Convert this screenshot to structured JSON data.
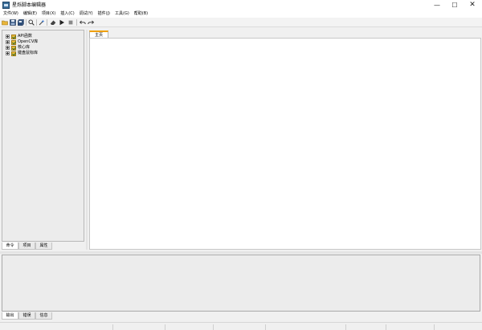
{
  "window": {
    "title": "星烁脚本编辑器",
    "controls": {
      "minimize": "—",
      "maximize": "☐",
      "close": "✕"
    }
  },
  "menu": [
    {
      "label": "文件(W)"
    },
    {
      "label": "编辑(E)"
    },
    {
      "label": "项目(X)"
    },
    {
      "label": "插入(C)"
    },
    {
      "label": "调试(Y)"
    },
    {
      "label": "插件(J)"
    },
    {
      "label": "工具(G)"
    },
    {
      "label": "帮助(B)"
    }
  ],
  "toolbar": {
    "icons": [
      "open-folder-icon",
      "save-icon",
      "save-all-icon",
      "search-icon",
      "build-icon",
      "eraser-icon",
      "run-icon",
      "stop-icon",
      "undo-icon",
      "redo-icon"
    ]
  },
  "tree": {
    "items": [
      {
        "label": "API函数"
      },
      {
        "label": "OpenCV库"
      },
      {
        "label": "核心库"
      },
      {
        "label": "键盘鼠标库"
      }
    ]
  },
  "left_tabs": [
    {
      "label": "命令",
      "active": true
    },
    {
      "label": "项目",
      "active": false
    },
    {
      "label": "属性",
      "active": false
    }
  ],
  "editor": {
    "tabs": [
      {
        "label": "主页",
        "active": true
      }
    ]
  },
  "bottom_tabs": [
    {
      "label": "输出",
      "active": true
    },
    {
      "label": "错误",
      "active": false
    },
    {
      "label": "信息",
      "active": false
    }
  ],
  "colors": {
    "accent_tab_border": "#f0a000",
    "folder_icon": "#e8b93a",
    "app_icon": "#3c6f9a"
  }
}
